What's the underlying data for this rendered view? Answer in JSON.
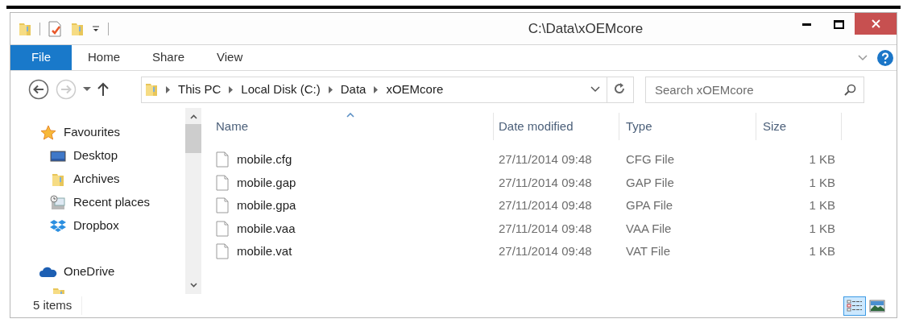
{
  "window": {
    "title": "C:\\Data\\xOEMcore"
  },
  "ribbon": {
    "file_button": "File",
    "tabs": [
      "Home",
      "Share",
      "View"
    ]
  },
  "address_bar": {
    "path": [
      "This PC",
      "Local Disk (C:)",
      "Data",
      "xOEMcore"
    ]
  },
  "search": {
    "placeholder": "Search xOEMcore"
  },
  "navigation_pane": {
    "items": [
      {
        "label": "Favourites",
        "kind": "star",
        "children": [
          {
            "label": "Desktop",
            "kind": "desktop"
          },
          {
            "label": "Archives",
            "kind": "folder"
          },
          {
            "label": "Recent places",
            "kind": "recent"
          },
          {
            "label": "Dropbox",
            "kind": "dropbox"
          }
        ]
      },
      {
        "label": "OneDrive",
        "kind": "cloud"
      }
    ]
  },
  "file_list": {
    "columns": [
      {
        "label": "Name",
        "sorted": true
      },
      {
        "label": "Date modified",
        "sorted": false
      },
      {
        "label": "Type",
        "sorted": false
      },
      {
        "label": "Size",
        "sorted": false
      }
    ],
    "rows": [
      {
        "name": "mobile.cfg",
        "date_modified": "27/11/2014 09:48",
        "type": "CFG File",
        "size": "1 KB"
      },
      {
        "name": "mobile.gap",
        "date_modified": "27/11/2014 09:48",
        "type": "GAP File",
        "size": "1 KB"
      },
      {
        "name": "mobile.gpa",
        "date_modified": "27/11/2014 09:48",
        "type": "GPA File",
        "size": "1 KB"
      },
      {
        "name": "mobile.vaa",
        "date_modified": "27/11/2014 09:48",
        "type": "VAA File",
        "size": "1 KB"
      },
      {
        "name": "mobile.vat",
        "date_modified": "27/11/2014 09:48",
        "type": "VAT File",
        "size": "1 KB"
      }
    ]
  },
  "status_bar": {
    "item_count": "5 items"
  },
  "view_buttons": [
    {
      "kind": "details",
      "selected": true
    },
    {
      "kind": "large_icons",
      "selected": false
    }
  ]
}
